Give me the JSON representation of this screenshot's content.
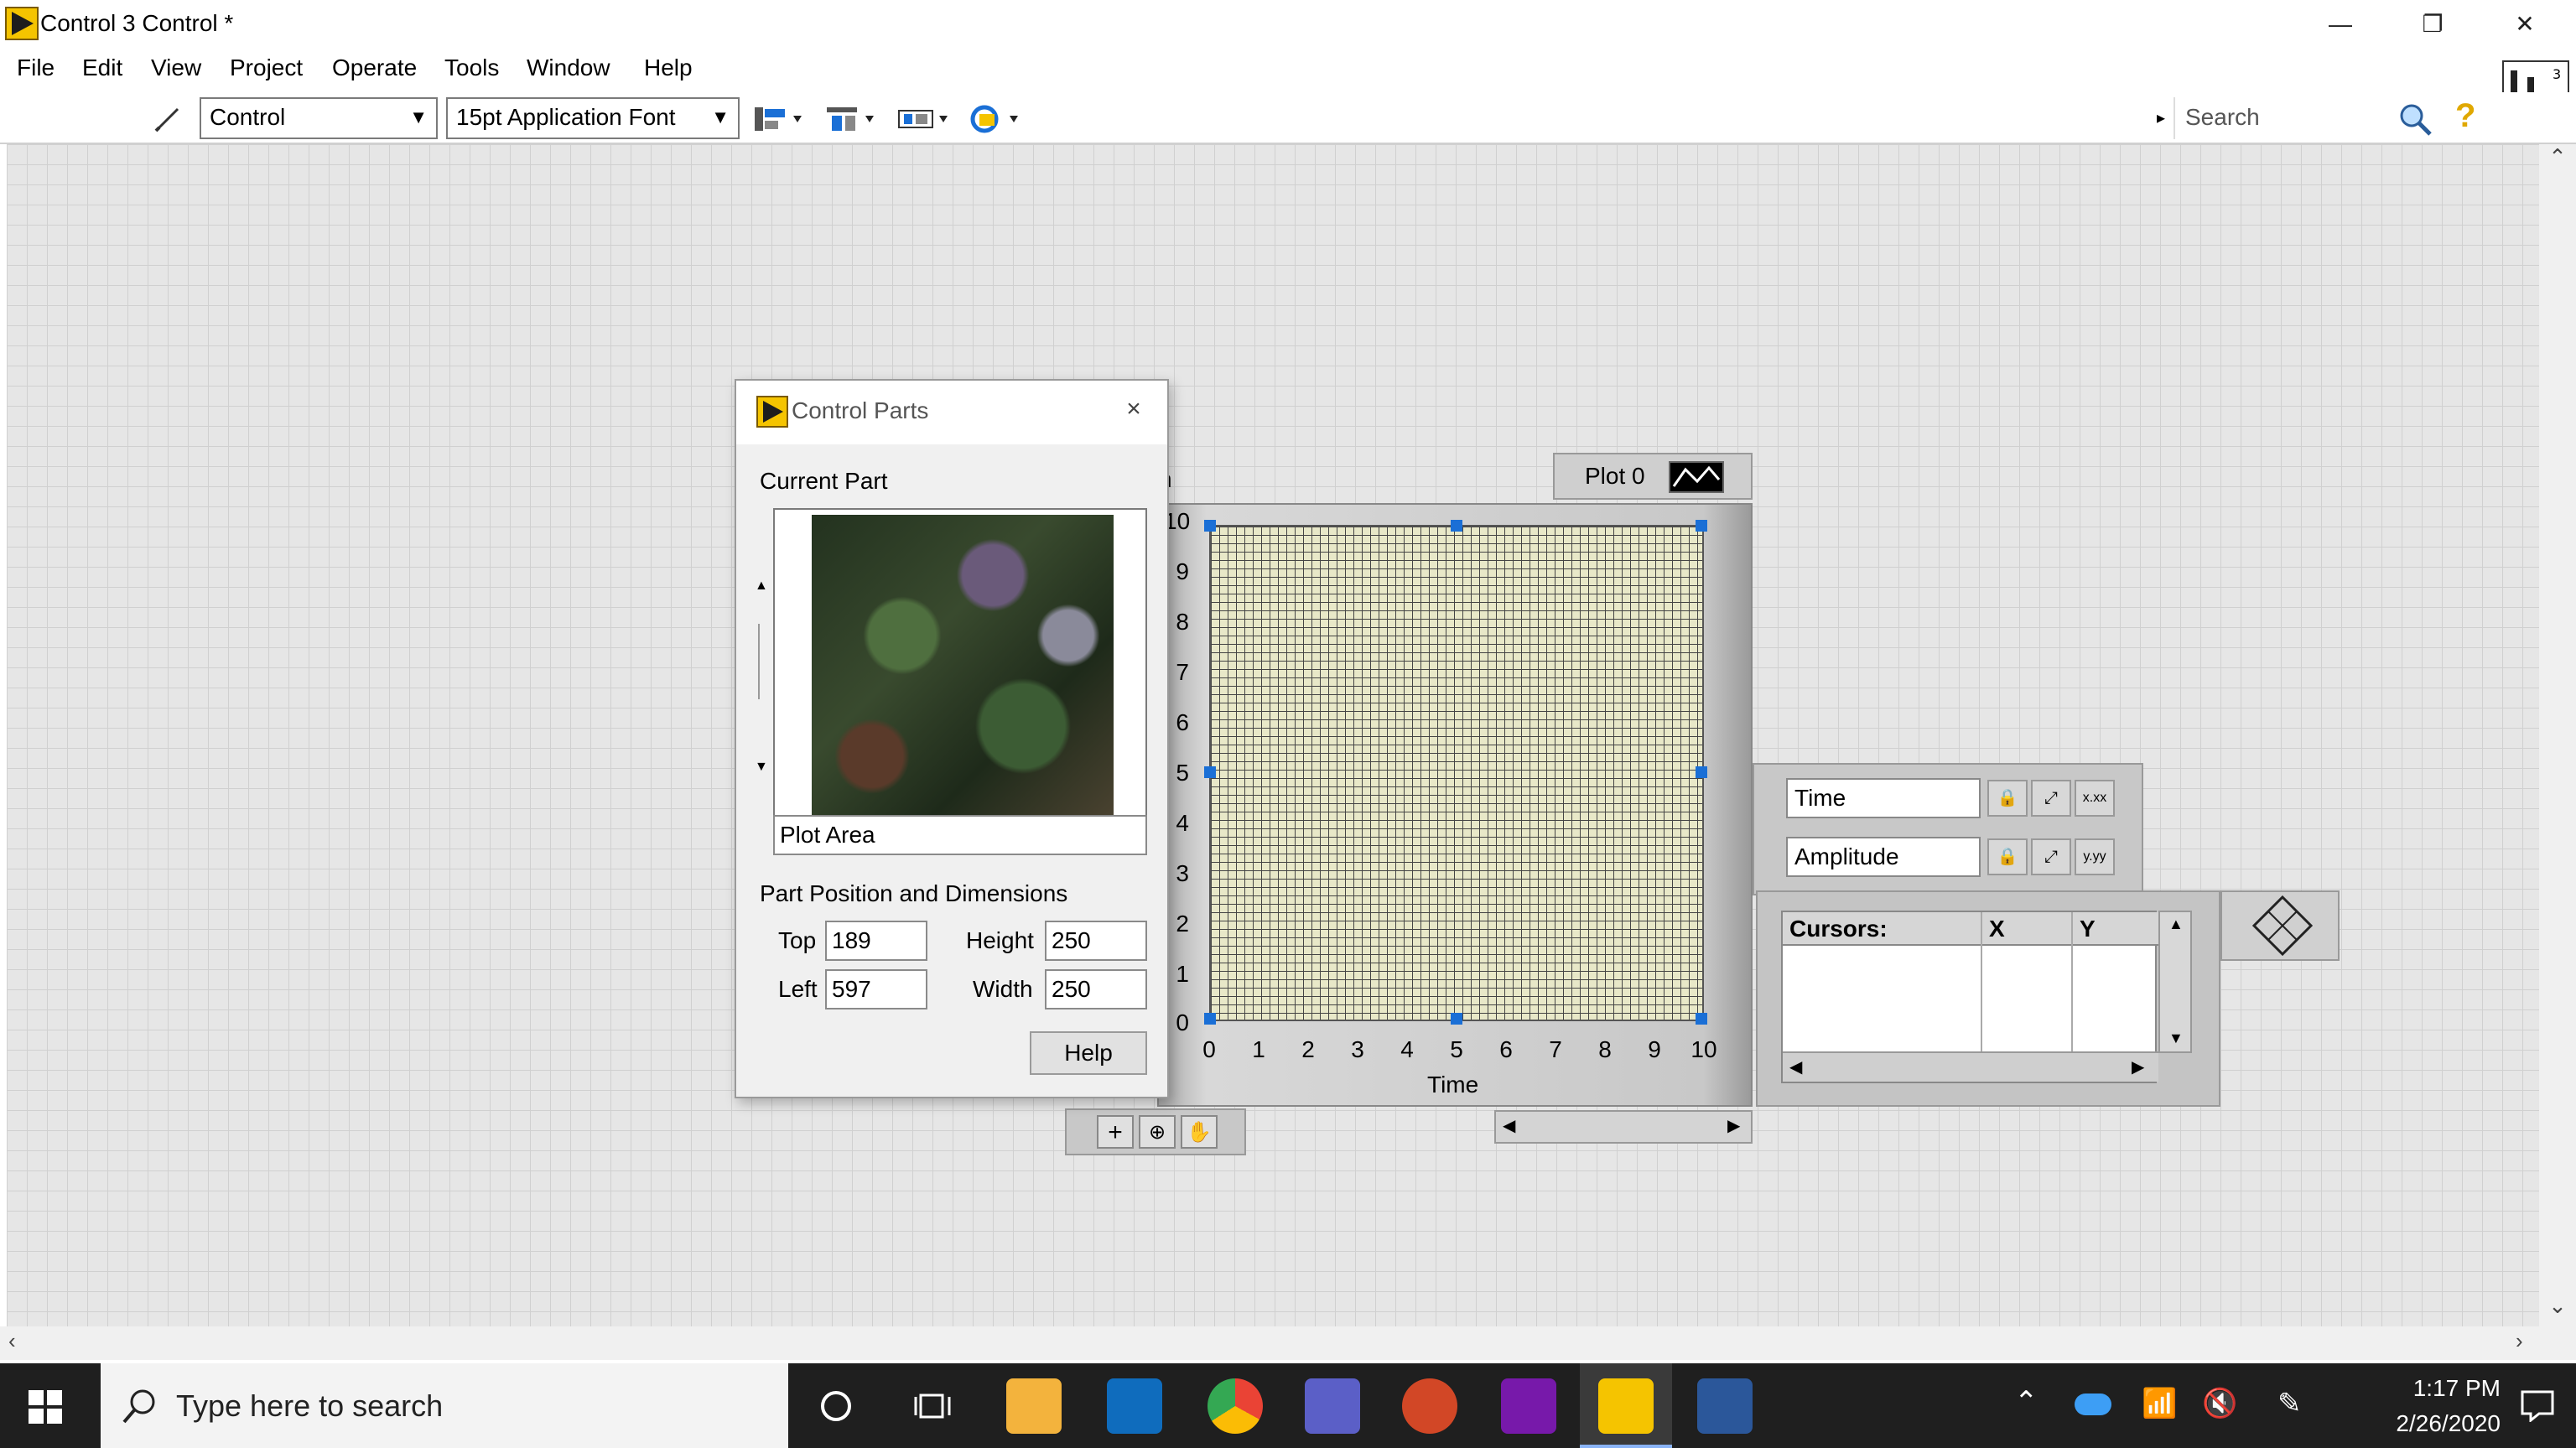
{
  "window": {
    "title": "Control 3 Control *",
    "minimize_glyph": "—",
    "restore_glyph": "❐",
    "close_glyph": "✕"
  },
  "menu": [
    "File",
    "Edit",
    "View",
    "Project",
    "Operate",
    "Tools",
    "Window",
    "Help"
  ],
  "toolbar": {
    "mode_select": "Control",
    "font_select": "15pt Application Font",
    "search_placeholder": "Search",
    "help_glyph": "?"
  },
  "dialog": {
    "title": "Control Parts",
    "close_glyph": "×",
    "current_part_label": "Current Part",
    "current_part_value": "Plot Area",
    "position_label": "Part Position and Dimensions",
    "top_label": "Top",
    "top_value": "189",
    "left_label": "Left",
    "left_value": "597",
    "height_label": "Height",
    "height_value": "250",
    "width_label": "Width",
    "width_value": "250",
    "help_button": "Help",
    "spin_up": "▲",
    "spin_down": "▼"
  },
  "graph": {
    "label_fragment": "h",
    "plot_legend": "Plot 0",
    "x_axis_label": "Time",
    "y_ticks": [
      "10",
      "9",
      "8",
      "7",
      "6",
      "5",
      "4",
      "3",
      "2",
      "1",
      "0"
    ],
    "x_ticks": [
      "0",
      "1",
      "2",
      "3",
      "4",
      "5",
      "6",
      "7",
      "8",
      "9",
      "10"
    ],
    "scale_legend": {
      "x_name": "Time",
      "y_name": "Amplitude",
      "x_format": "x.xx",
      "y_format": "y.yy"
    },
    "cursor_legend": {
      "col_name": "Cursors:",
      "col_x": "X",
      "col_y": "Y"
    }
  },
  "taskbar": {
    "search_placeholder": "Type here to search",
    "time": "1:17 PM",
    "date": "2/26/2020"
  },
  "colors": {
    "taskbar_bg": "#1f1f1f",
    "canvas_bg": "#e6e6e6",
    "plot_bg": "#e8e8c8",
    "selection_handle": "#1a6fd6",
    "labview_yellow": "#f5c400"
  }
}
